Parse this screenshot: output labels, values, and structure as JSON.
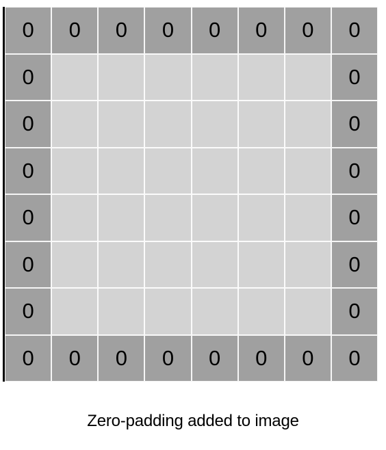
{
  "diagram": {
    "rows": 8,
    "cols": 8,
    "padding_width": 1,
    "pad_value": "0",
    "pad_color": "#a0a0a0",
    "inner_color": "#d3d3d3",
    "caption": "Zero-padding added to image"
  }
}
